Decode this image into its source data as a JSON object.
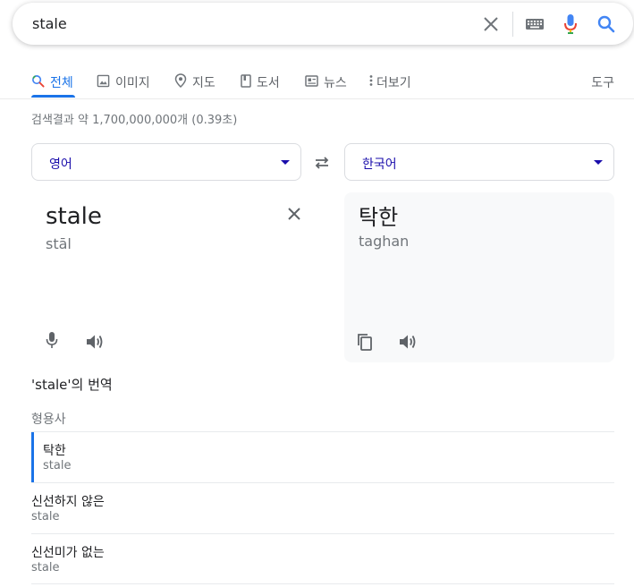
{
  "search": {
    "query": "stale",
    "clear_icon": "close-icon",
    "keyboard_icon": "keyboard-icon",
    "mic_icon": "mic-icon",
    "search_icon": "search-icon"
  },
  "tabs": [
    {
      "label": "전체",
      "icon": "search-icon",
      "active": true
    },
    {
      "label": "이미지",
      "icon": "image-icon"
    },
    {
      "label": "지도",
      "icon": "map-pin-icon"
    },
    {
      "label": "도서",
      "icon": "book-icon"
    },
    {
      "label": "뉴스",
      "icon": "news-icon"
    },
    {
      "label": "더보기",
      "icon": "more-vert-icon"
    }
  ],
  "tools_label": "도구",
  "result_stats": "검색결과 약 1,700,000,000개 (0.39초)",
  "translator": {
    "source_lang": "영어",
    "target_lang": "한국어",
    "source_text": "stale",
    "source_translit": "stāl",
    "target_text": "탁한",
    "target_translit": "taghan"
  },
  "translations": {
    "heading": "'stale'의 번역",
    "part_of_speech": "형용사",
    "items": [
      {
        "word": "탁한",
        "source": "stale",
        "selected": true
      },
      {
        "word": "신선하지 않은",
        "source": "stale"
      },
      {
        "word": "신선미가 없는",
        "source": "stale"
      }
    ]
  },
  "colors": {
    "accent": "#1a73e8",
    "link": "#1a0dab",
    "secondary_text": "#70757a"
  }
}
